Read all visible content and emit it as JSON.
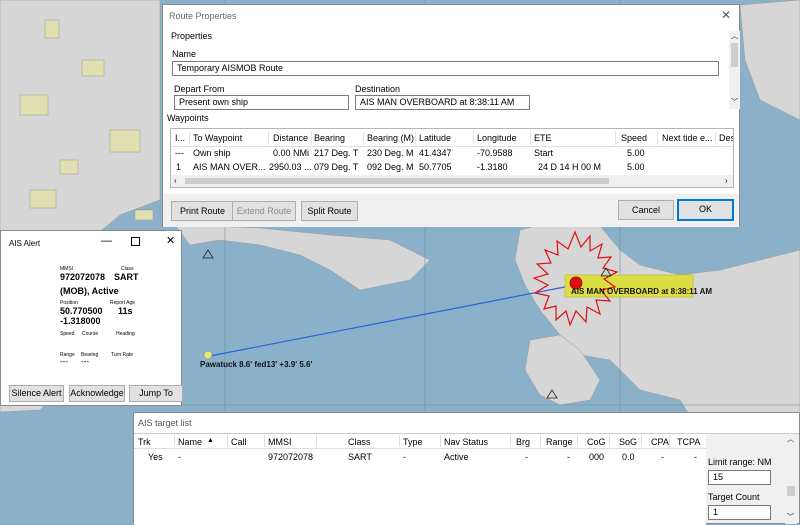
{
  "map": {
    "mob_label": "AIS MAN OVERBOARD at 8:38:11 AM",
    "ship_label": "Pawatuck 8.6' fed13' +3.9' 5.6'"
  },
  "route_properties": {
    "title": "Route Properties",
    "properties_group": "Properties",
    "name_label": "Name",
    "name_value": "Temporary AISMOB Route",
    "depart_label": "Depart From",
    "depart_value": "Present own ship",
    "destination_label": "Destination",
    "destination_value": "AIS MAN OVERBOARD at 8:38:11 AM",
    "waypoints_label": "Waypoints",
    "columns": [
      "I...",
      "To Waypoint",
      "Distance",
      "Bearing",
      "Bearing (M)",
      "Latitude",
      "Longitude",
      "ETE",
      "Speed",
      "Next tide e...",
      "Des"
    ],
    "rows": [
      [
        "---",
        "Own ship",
        "0.00 NMi",
        "217 Deg. T",
        "230 Deg. M",
        "41.4347",
        "-70.9588",
        "Start",
        "5.00",
        "",
        ""
      ],
      [
        "1",
        "AIS MAN OVER...",
        "2950.03 ...",
        "079 Deg. T",
        "092 Deg. M",
        "50.7705",
        "-1.3180",
        "24 D  14 H  00 M",
        "5.00",
        "",
        ""
      ]
    ],
    "buttons": {
      "print": "Print Route",
      "extend": "Extend Route",
      "split": "Split Route",
      "cancel": "Cancel",
      "ok": "OK"
    }
  },
  "ais_alert": {
    "title": "AIS Alert",
    "mmsi_label": "MMSI",
    "mmsi_value": "972072078",
    "class_label": "Class",
    "class_value": "SART",
    "status": "(MOB), Active",
    "position_label": "Position",
    "lat": "50.770500",
    "lon": "-1.318000",
    "report_age_label": "Report Age",
    "report_age_value": "11s",
    "speed_label": "Speed",
    "course_label": "Course",
    "heading_label": "Heading",
    "range_label": "Range",
    "bearing_label": "Bearing",
    "turn_rate_label": "Turn Rate",
    "range_value": "---",
    "bearing_value": "---",
    "buttons": {
      "silence": "Silence Alert",
      "acknowledge": "Acknowledge",
      "jump": "Jump To"
    }
  },
  "target_list": {
    "title": "AIS target list",
    "columns": [
      "Trk",
      "Name",
      "Call",
      "MMSI",
      "Class",
      "Type",
      "Nav Status",
      "Brg",
      "Range",
      "CoG",
      "SoG",
      "CPA",
      "TCPA"
    ],
    "sort_indicator": "▲",
    "rows": [
      [
        "Yes",
        "-",
        "",
        "972072078",
        "SART",
        "-",
        "Active",
        "-",
        "-",
        "000",
        "0.0",
        "-",
        "-"
      ]
    ],
    "limit_range_label": "Limit range: NM",
    "limit_range_value": "15",
    "target_count_label": "Target Count",
    "target_count_value": "1"
  }
}
